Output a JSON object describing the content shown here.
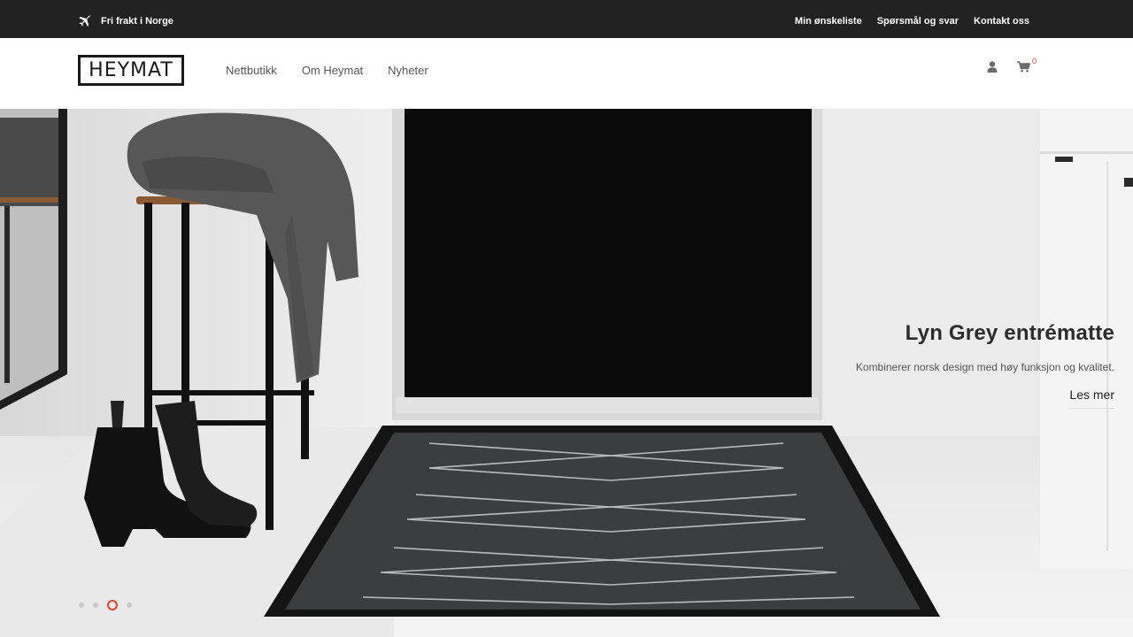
{
  "topbar": {
    "shipping_icon": "plane-icon",
    "shipping_text": "Fri frakt i Norge",
    "links": [
      "Min ønskeliste",
      "Spørsmål og svar",
      "Kontakt oss"
    ]
  },
  "header": {
    "logo_text": "HEYMAT",
    "nav": [
      "Nettbutikk",
      "Om Heymat",
      "Nyheter"
    ],
    "user_icon": "user-icon",
    "cart_icon": "cart-icon",
    "cart_count": "0"
  },
  "hero": {
    "title": "Lyn Grey entrématte",
    "subtitle": "Kombinerer norsk design med høy funksjon og kvalitet.",
    "cta": "Les mer",
    "slides": 4,
    "active_slide": 3
  },
  "colors": {
    "topbar_bg": "#222222",
    "accent": "#e8452c"
  }
}
